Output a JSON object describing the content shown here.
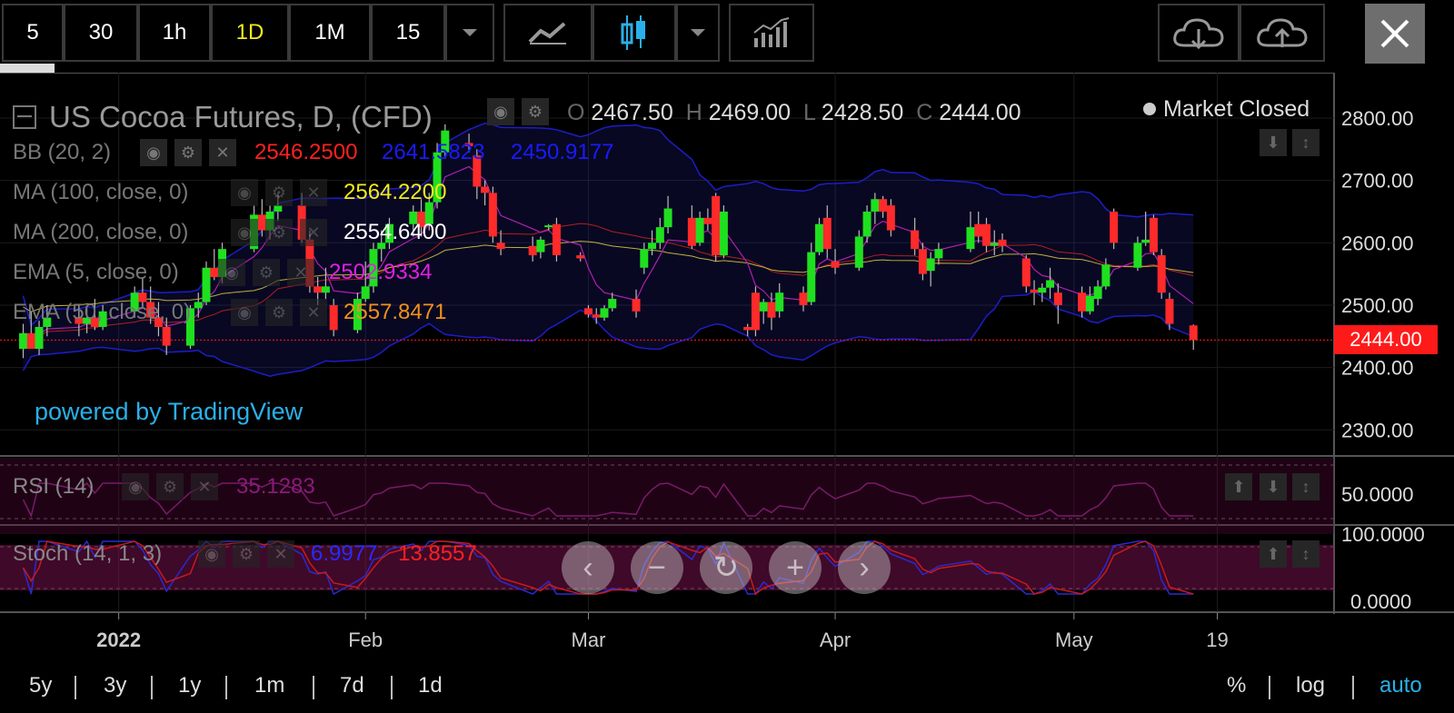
{
  "toolbar": {
    "intervals": [
      "5",
      "30",
      "1h",
      "1D",
      "1M",
      "15"
    ],
    "active_interval": "1D"
  },
  "header": {
    "title": "US Cocoa Futures, D, (CFD)",
    "ohlc": {
      "o_label": "O",
      "o": "2467.50",
      "h_label": "H",
      "h": "2469.00",
      "l_label": "L",
      "l": "2428.50",
      "c_label": "C",
      "c": "2444.00"
    },
    "market_status": "Market Closed"
  },
  "indicators": {
    "bb": {
      "label": "BB (20, 2)",
      "v1": "2546.2500",
      "v2": "2641.5823",
      "v3": "2450.9177",
      "c1": "#ff2020",
      "c2": "#1a1aff",
      "c3": "#1a1aff"
    },
    "ma100": {
      "label": "MA (100, close, 0)",
      "value": "2564.2200",
      "color": "#f2ea1c"
    },
    "ma200": {
      "label": "MA (200, close, 0)",
      "value": "2554.6400",
      "color": "#ffffff"
    },
    "ema1": {
      "label": "EMA (5, close, 0)",
      "value": "2502.9334",
      "color": "#e020e0"
    },
    "ema2": {
      "label": "EMA (50, close, 0)",
      "value": "2557.8471",
      "color": "#f2901c"
    }
  },
  "watermark": "powered by TradingView",
  "rsi": {
    "label": "RSI (14)",
    "value": "35.1283",
    "axis_label": "50.0000"
  },
  "stoch": {
    "label": "Stoch (14, 1, 3)",
    "k": "6.9977",
    "d": "13.8557",
    "axis_top": "100.0000",
    "axis_bottom": "0.0000"
  },
  "price_badge": "2444.00",
  "range_buttons": [
    "5y",
    "3y",
    "1y",
    "1m",
    "7d",
    "1d"
  ],
  "scale_buttons": {
    "pct": "%",
    "log": "log",
    "auto": "auto"
  },
  "colors": {
    "up": "#1fe01f",
    "down": "#ff2a2a",
    "accent_blue": "#2ab0e8",
    "badge": "#ff1a1a"
  },
  "chart_data": {
    "type": "candlestick",
    "x_ticks": [
      "2022",
      "Feb",
      "Mar",
      "Apr",
      "May",
      "19"
    ],
    "y_ticks": [
      "2800.00",
      "2700.00",
      "2600.00",
      "2500.00",
      "2400.00",
      "2300.00"
    ],
    "ylim": [
      2250,
      2850
    ],
    "candles": [
      {
        "d": "2021-12-20",
        "o": 2430,
        "h": 2470,
        "l": 2415,
        "c": 2455
      },
      {
        "d": "2021-12-21",
        "o": 2455,
        "h": 2490,
        "l": 2440,
        "c": 2430
      },
      {
        "d": "2021-12-22",
        "o": 2430,
        "h": 2475,
        "l": 2420,
        "c": 2465
      },
      {
        "d": "2021-12-23",
        "o": 2465,
        "h": 2500,
        "l": 2450,
        "c": 2480
      },
      {
        "d": "2021-12-27",
        "o": 2480,
        "h": 2500,
        "l": 2450,
        "c": 2470
      },
      {
        "d": "2021-12-28",
        "o": 2470,
        "h": 2495,
        "l": 2455,
        "c": 2480
      },
      {
        "d": "2021-12-29",
        "o": 2480,
        "h": 2510,
        "l": 2460,
        "c": 2465
      },
      {
        "d": "2021-12-30",
        "o": 2465,
        "h": 2500,
        "l": 2460,
        "c": 2490
      },
      {
        "d": "2022-01-03",
        "o": 2490,
        "h": 2530,
        "l": 2480,
        "c": 2520
      },
      {
        "d": "2022-01-04",
        "o": 2520,
        "h": 2545,
        "l": 2495,
        "c": 2505
      },
      {
        "d": "2022-01-05",
        "o": 2505,
        "h": 2530,
        "l": 2470,
        "c": 2480
      },
      {
        "d": "2022-01-06",
        "o": 2480,
        "h": 2505,
        "l": 2450,
        "c": 2465
      },
      {
        "d": "2022-01-07",
        "o": 2465,
        "h": 2480,
        "l": 2420,
        "c": 2435
      },
      {
        "d": "2022-01-10",
        "o": 2435,
        "h": 2500,
        "l": 2430,
        "c": 2495
      },
      {
        "d": "2022-01-11",
        "o": 2495,
        "h": 2520,
        "l": 2480,
        "c": 2505
      },
      {
        "d": "2022-01-12",
        "o": 2505,
        "h": 2570,
        "l": 2500,
        "c": 2560
      },
      {
        "d": "2022-01-13",
        "o": 2560,
        "h": 2590,
        "l": 2540,
        "c": 2545
      },
      {
        "d": "2022-01-14",
        "o": 2545,
        "h": 2600,
        "l": 2535,
        "c": 2590
      },
      {
        "d": "2022-01-18",
        "o": 2590,
        "h": 2660,
        "l": 2585,
        "c": 2645
      },
      {
        "d": "2022-01-19",
        "o": 2645,
        "h": 2670,
        "l": 2610,
        "c": 2620
      },
      {
        "d": "2022-01-20",
        "o": 2620,
        "h": 2660,
        "l": 2605,
        "c": 2650
      },
      {
        "d": "2022-01-21",
        "o": 2650,
        "h": 2680,
        "l": 2635,
        "c": 2660
      },
      {
        "d": "2022-01-24",
        "o": 2660,
        "h": 2680,
        "l": 2600,
        "c": 2605
      },
      {
        "d": "2022-01-25",
        "o": 2605,
        "h": 2620,
        "l": 2520,
        "c": 2530
      },
      {
        "d": "2022-01-26",
        "o": 2530,
        "h": 2545,
        "l": 2500,
        "c": 2520
      },
      {
        "d": "2022-01-27",
        "o": 2520,
        "h": 2560,
        "l": 2510,
        "c": 2530
      },
      {
        "d": "2022-01-28",
        "o": 2500,
        "h": 2510,
        "l": 2450,
        "c": 2460
      },
      {
        "d": "2022-01-31",
        "o": 2460,
        "h": 2520,
        "l": 2455,
        "c": 2510
      },
      {
        "d": "2022-02-01",
        "o": 2510,
        "h": 2570,
        "l": 2505,
        "c": 2530
      },
      {
        "d": "2022-02-02",
        "o": 2530,
        "h": 2600,
        "l": 2520,
        "c": 2590
      },
      {
        "d": "2022-02-03",
        "o": 2590,
        "h": 2620,
        "l": 2570,
        "c": 2600
      },
      {
        "d": "2022-02-04",
        "o": 2600,
        "h": 2640,
        "l": 2590,
        "c": 2630
      },
      {
        "d": "2022-02-07",
        "o": 2630,
        "h": 2660,
        "l": 2610,
        "c": 2650
      },
      {
        "d": "2022-02-08",
        "o": 2650,
        "h": 2670,
        "l": 2610,
        "c": 2625
      },
      {
        "d": "2022-02-09",
        "o": 2630,
        "h": 2680,
        "l": 2620,
        "c": 2665
      },
      {
        "d": "2022-02-10",
        "o": 2665,
        "h": 2760,
        "l": 2655,
        "c": 2745
      },
      {
        "d": "2022-02-11",
        "o": 2745,
        "h": 2790,
        "l": 2735,
        "c": 2780
      },
      {
        "d": "2022-02-14",
        "o": 2760,
        "h": 2775,
        "l": 2745,
        "c": 2755
      },
      {
        "d": "2022-02-15",
        "o": 2740,
        "h": 2750,
        "l": 2670,
        "c": 2690
      },
      {
        "d": "2022-02-16",
        "o": 2690,
        "h": 2700,
        "l": 2660,
        "c": 2680
      },
      {
        "d": "2022-02-17",
        "o": 2680,
        "h": 2690,
        "l": 2600,
        "c": 2610
      },
      {
        "d": "2022-02-18",
        "o": 2600,
        "h": 2620,
        "l": 2580,
        "c": 2590
      },
      {
        "d": "2022-02-22",
        "o": 2595,
        "h": 2610,
        "l": 2570,
        "c": 2580
      },
      {
        "d": "2022-02-23",
        "o": 2585,
        "h": 2610,
        "l": 2575,
        "c": 2605
      },
      {
        "d": "2022-02-24",
        "o": 2625,
        "h": 2630,
        "l": 2620,
        "c": 2628
      },
      {
        "d": "2022-02-25",
        "o": 2630,
        "h": 2640,
        "l": 2570,
        "c": 2580
      },
      {
        "d": "2022-02-28",
        "o": 2580,
        "h": 2585,
        "l": 2570,
        "c": 2575
      },
      {
        "d": "2022-03-01",
        "o": 2495,
        "h": 2500,
        "l": 2480,
        "c": 2485
      },
      {
        "d": "2022-03-02",
        "o": 2485,
        "h": 2495,
        "l": 2470,
        "c": 2480
      },
      {
        "d": "2022-03-03",
        "o": 2480,
        "h": 2500,
        "l": 2475,
        "c": 2495
      },
      {
        "d": "2022-03-04",
        "o": 2495,
        "h": 2520,
        "l": 2490,
        "c": 2510
      },
      {
        "d": "2022-03-07",
        "o": 2510,
        "h": 2525,
        "l": 2480,
        "c": 2490
      },
      {
        "d": "2022-03-08",
        "o": 2560,
        "h": 2600,
        "l": 2550,
        "c": 2590
      },
      {
        "d": "2022-03-09",
        "o": 2590,
        "h": 2620,
        "l": 2580,
        "c": 2600
      },
      {
        "d": "2022-03-10",
        "o": 2600,
        "h": 2640,
        "l": 2590,
        "c": 2625
      },
      {
        "d": "2022-03-11",
        "o": 2625,
        "h": 2675,
        "l": 2615,
        "c": 2655
      },
      {
        "d": "2022-03-14",
        "o": 2640,
        "h": 2660,
        "l": 2590,
        "c": 2595
      },
      {
        "d": "2022-03-15",
        "o": 2600,
        "h": 2650,
        "l": 2595,
        "c": 2640
      },
      {
        "d": "2022-03-16",
        "o": 2640,
        "h": 2655,
        "l": 2620,
        "c": 2630
      },
      {
        "d": "2022-03-17",
        "o": 2675,
        "h": 2680,
        "l": 2570,
        "c": 2580
      },
      {
        "d": "2022-03-18",
        "o": 2580,
        "h": 2660,
        "l": 2575,
        "c": 2650
      },
      {
        "d": "2022-03-21",
        "o": 2465,
        "h": 2470,
        "l": 2450,
        "c": 2460
      },
      {
        "d": "2022-03-22",
        "o": 2520,
        "h": 2530,
        "l": 2450,
        "c": 2460
      },
      {
        "d": "2022-03-23",
        "o": 2490,
        "h": 2510,
        "l": 2470,
        "c": 2505
      },
      {
        "d": "2022-03-24",
        "o": 2505,
        "h": 2520,
        "l": 2460,
        "c": 2480
      },
      {
        "d": "2022-03-25",
        "o": 2490,
        "h": 2535,
        "l": 2480,
        "c": 2520
      },
      {
        "d": "2022-03-28",
        "o": 2520,
        "h": 2530,
        "l": 2490,
        "c": 2500
      },
      {
        "d": "2022-03-29",
        "o": 2505,
        "h": 2600,
        "l": 2500,
        "c": 2585
      },
      {
        "d": "2022-03-30",
        "o": 2585,
        "h": 2640,
        "l": 2580,
        "c": 2630
      },
      {
        "d": "2022-03-31",
        "o": 2640,
        "h": 2660,
        "l": 2575,
        "c": 2590
      },
      {
        "d": "2022-04-01",
        "o": 2570,
        "h": 2590,
        "l": 2550,
        "c": 2560
      },
      {
        "d": "2022-04-04",
        "o": 2560,
        "h": 2620,
        "l": 2555,
        "c": 2610
      },
      {
        "d": "2022-04-05",
        "o": 2610,
        "h": 2660,
        "l": 2600,
        "c": 2650
      },
      {
        "d": "2022-04-06",
        "o": 2650,
        "h": 2680,
        "l": 2630,
        "c": 2670
      },
      {
        "d": "2022-04-07",
        "o": 2670,
        "h": 2675,
        "l": 2640,
        "c": 2650
      },
      {
        "d": "2022-04-08",
        "o": 2660,
        "h": 2670,
        "l": 2610,
        "c": 2620
      },
      {
        "d": "2022-04-11",
        "o": 2620,
        "h": 2640,
        "l": 2580,
        "c": 2590
      },
      {
        "d": "2022-04-12",
        "o": 2590,
        "h": 2600,
        "l": 2540,
        "c": 2550
      },
      {
        "d": "2022-04-13",
        "o": 2555,
        "h": 2585,
        "l": 2530,
        "c": 2575
      },
      {
        "d": "2022-04-14",
        "o": 2575,
        "h": 2600,
        "l": 2565,
        "c": 2590
      },
      {
        "d": "2022-04-18",
        "o": 2590,
        "h": 2650,
        "l": 2585,
        "c": 2625
      },
      {
        "d": "2022-04-19",
        "o": 2630,
        "h": 2650,
        "l": 2600,
        "c": 2610
      },
      {
        "d": "2022-04-20",
        "o": 2630,
        "h": 2640,
        "l": 2585,
        "c": 2595
      },
      {
        "d": "2022-04-21",
        "o": 2595,
        "h": 2620,
        "l": 2580,
        "c": 2600
      },
      {
        "d": "2022-04-22",
        "o": 2605,
        "h": 2615,
        "l": 2585,
        "c": 2595
      },
      {
        "d": "2022-04-25",
        "o": 2575,
        "h": 2580,
        "l": 2520,
        "c": 2530
      },
      {
        "d": "2022-04-26",
        "o": 2525,
        "h": 2540,
        "l": 2500,
        "c": 2520
      },
      {
        "d": "2022-04-27",
        "o": 2520,
        "h": 2535,
        "l": 2505,
        "c": 2528
      },
      {
        "d": "2022-04-28",
        "o": 2528,
        "h": 2560,
        "l": 2510,
        "c": 2540
      },
      {
        "d": "2022-04-29",
        "o": 2520,
        "h": 2535,
        "l": 2470,
        "c": 2500
      },
      {
        "d": "2022-05-02",
        "o": 2520,
        "h": 2530,
        "l": 2480,
        "c": 2490
      },
      {
        "d": "2022-05-03",
        "o": 2490,
        "h": 2530,
        "l": 2485,
        "c": 2515
      },
      {
        "d": "2022-05-04",
        "o": 2510,
        "h": 2540,
        "l": 2500,
        "c": 2530
      },
      {
        "d": "2022-05-05",
        "o": 2530,
        "h": 2575,
        "l": 2525,
        "c": 2565
      },
      {
        "d": "2022-05-06",
        "o": 2650,
        "h": 2655,
        "l": 2590,
        "c": 2600
      },
      {
        "d": "2022-05-09",
        "o": 2560,
        "h": 2610,
        "l": 2555,
        "c": 2600
      },
      {
        "d": "2022-05-10",
        "o": 2600,
        "h": 2650,
        "l": 2595,
        "c": 2605
      },
      {
        "d": "2022-05-11",
        "o": 2640,
        "h": 2645,
        "l": 2580,
        "c": 2585
      },
      {
        "d": "2022-05-12",
        "o": 2580,
        "h": 2590,
        "l": 2510,
        "c": 2520
      },
      {
        "d": "2022-05-13",
        "o": 2510,
        "h": 2520,
        "l": 2460,
        "c": 2470
      },
      {
        "d": "2022-05-16",
        "o": 2467.5,
        "h": 2469,
        "l": 2428.5,
        "c": 2444
      }
    ]
  }
}
